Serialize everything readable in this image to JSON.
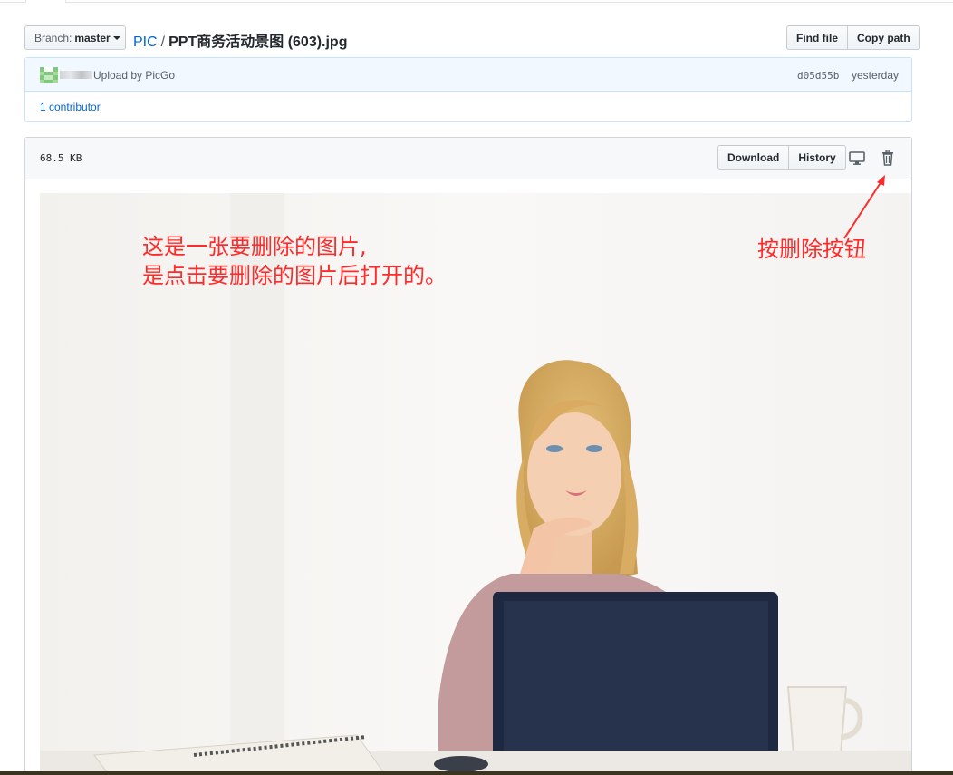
{
  "branch": {
    "prefix": "Branch:",
    "name": "master"
  },
  "breadcrumb": {
    "repo": "PIC",
    "separator": "/",
    "file": "PPT商务活动景图 (603).jpg"
  },
  "file_actions": {
    "find_file": "Find file",
    "copy_path": "Copy path"
  },
  "commit": {
    "message": "Upload by PicGo",
    "sha": "d05d55b",
    "time": "yesterday"
  },
  "contributors": "1 contributor",
  "file": {
    "size": "68.5 KB",
    "download": "Download",
    "history": "History"
  },
  "annotations": {
    "line1": "这是一张要删除的图片,",
    "line2": "是点击要删除的图片后打开的。",
    "delete_hint": "按删除按钮"
  },
  "icons": [
    "desktop-icon",
    "trash-icon",
    "caret-down-icon",
    "avatar-identicon"
  ],
  "colors": {
    "link": "#0366d6",
    "annotation": "#ff2a2a",
    "commit_bg": "#f1f8ff"
  }
}
